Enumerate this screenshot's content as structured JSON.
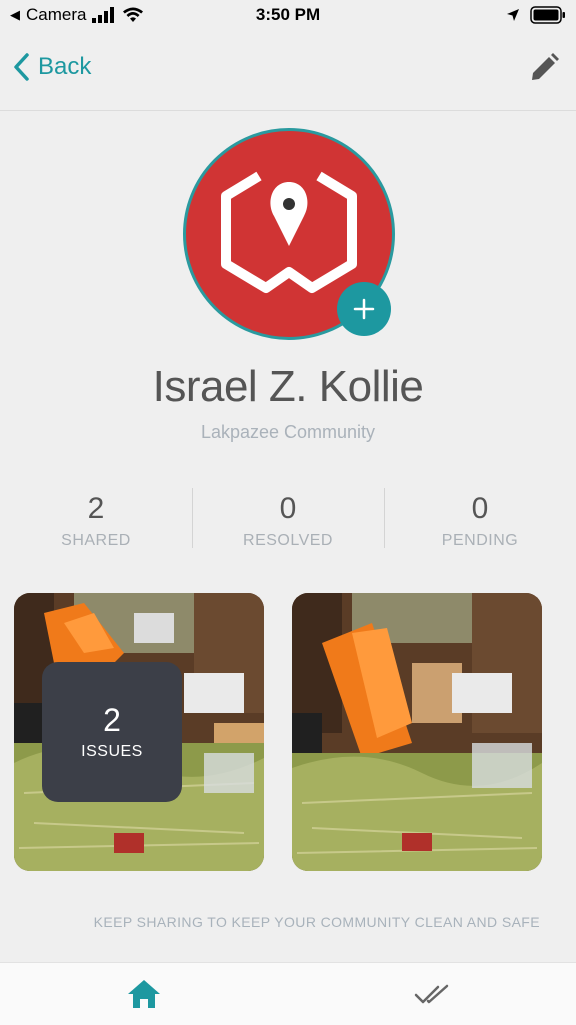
{
  "status_bar": {
    "back_app": "Camera",
    "time": "3:50 PM"
  },
  "nav": {
    "back_label": "Back",
    "edit_icon": "pencil-icon"
  },
  "profile": {
    "name": "Israel Z. Kollie",
    "community": "Lakpazee Community",
    "avatar_icon": "logo-hexagon-pin-icon",
    "add_icon": "plus-icon"
  },
  "stats": [
    {
      "value": "2",
      "label": "SHARED"
    },
    {
      "value": "0",
      "label": "RESOLVED"
    },
    {
      "value": "0",
      "label": "PENDING"
    }
  ],
  "photos": {
    "overlay_count": "2",
    "overlay_label": "ISSUES"
  },
  "footer": {
    "tagline": "KEEP SHARING TO KEEP YOUR COMMUNITY CLEAN AND SAFE"
  },
  "tabs": [
    {
      "name": "home",
      "icon": "home-icon",
      "active": true
    },
    {
      "name": "resolved",
      "icon": "double-check-icon",
      "active": false
    }
  ],
  "colors": {
    "accent": "#1d98a0",
    "avatar_bg": "#d03434",
    "overlay_bg": "#3c3f48"
  }
}
